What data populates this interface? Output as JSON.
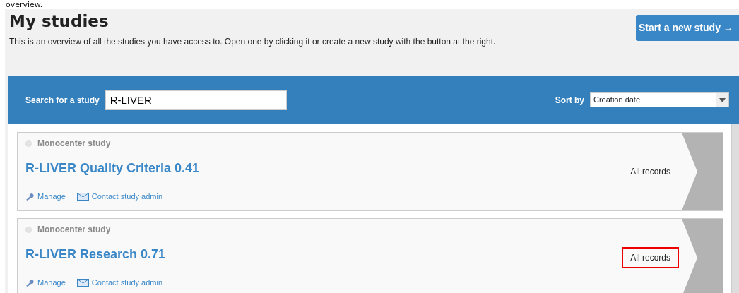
{
  "top_text": "overview.",
  "header": {
    "title": "My studies",
    "description": "This is an overview of all the studies you have access to. Open one by clicking it or create a new study with the button at the right.",
    "new_button": "Start a new study →"
  },
  "filter": {
    "search_label": "Search for a study",
    "search_value": "R-LIVER",
    "sort_label": "Sort by",
    "sort_value": "Creation date"
  },
  "studies": [
    {
      "type": "Monocenter study",
      "title": "R-LIVER Quality Criteria 0.41",
      "records": "All records",
      "highlighted": false,
      "links": [
        "Manage",
        "Contact study admin"
      ]
    },
    {
      "type": "Monocenter study",
      "title": "R-LIVER Research 0.71",
      "records": "All records",
      "highlighted": true,
      "links": [
        "Manage",
        "Contact study admin"
      ]
    }
  ]
}
